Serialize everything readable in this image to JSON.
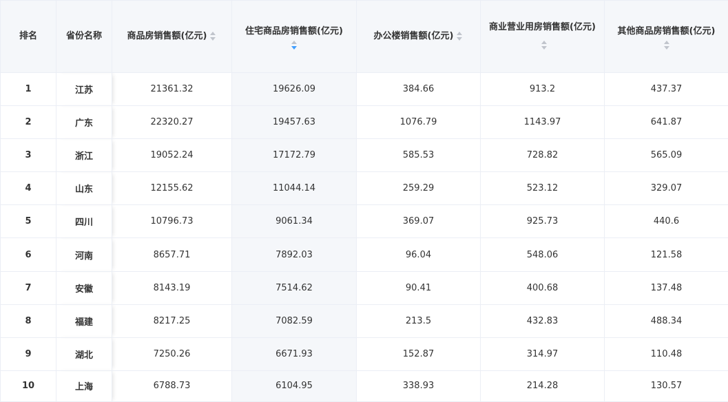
{
  "columns": {
    "rank": "排名",
    "province": "省份名称",
    "commercial": "商品房销售额(亿元)",
    "residential": "住宅商品房销售额(亿元)",
    "office": "办公楼销售额(亿元)",
    "business": "商业营业用房销售额(亿元)",
    "other": "其他商品房销售额(亿元)"
  },
  "sort": {
    "column": "residential",
    "order": "descending"
  },
  "rows": [
    {
      "rank": "1",
      "province": "江苏",
      "commercial": "21361.32",
      "residential": "19626.09",
      "office": "384.66",
      "business": "913.2",
      "other": "437.37"
    },
    {
      "rank": "2",
      "province": "广东",
      "commercial": "22320.27",
      "residential": "19457.63",
      "office": "1076.79",
      "business": "1143.97",
      "other": "641.87"
    },
    {
      "rank": "3",
      "province": "浙江",
      "commercial": "19052.24",
      "residential": "17172.79",
      "office": "585.53",
      "business": "728.82",
      "other": "565.09"
    },
    {
      "rank": "4",
      "province": "山东",
      "commercial": "12155.62",
      "residential": "11044.14",
      "office": "259.29",
      "business": "523.12",
      "other": "329.07"
    },
    {
      "rank": "5",
      "province": "四川",
      "commercial": "10796.73",
      "residential": "9061.34",
      "office": "369.07",
      "business": "925.73",
      "other": "440.6"
    },
    {
      "rank": "6",
      "province": "河南",
      "commercial": "8657.71",
      "residential": "7892.03",
      "office": "96.04",
      "business": "548.06",
      "other": "121.58"
    },
    {
      "rank": "7",
      "province": "安徽",
      "commercial": "8143.19",
      "residential": "7514.62",
      "office": "90.41",
      "business": "400.68",
      "other": "137.48"
    },
    {
      "rank": "8",
      "province": "福建",
      "commercial": "8217.25",
      "residential": "7082.59",
      "office": "213.5",
      "business": "432.83",
      "other": "488.34"
    },
    {
      "rank": "9",
      "province": "湖北",
      "commercial": "7250.26",
      "residential": "6671.93",
      "office": "152.87",
      "business": "314.97",
      "other": "110.48"
    },
    {
      "rank": "10",
      "province": "上海",
      "commercial": "6788.73",
      "residential": "6104.95",
      "office": "338.93",
      "business": "214.28",
      "other": "130.57"
    }
  ],
  "colors": {
    "border": "#ebeef5",
    "header_bg": "#f5f7fa",
    "sort_active": "#409eff",
    "sort_inactive": "#c0c4cc"
  }
}
